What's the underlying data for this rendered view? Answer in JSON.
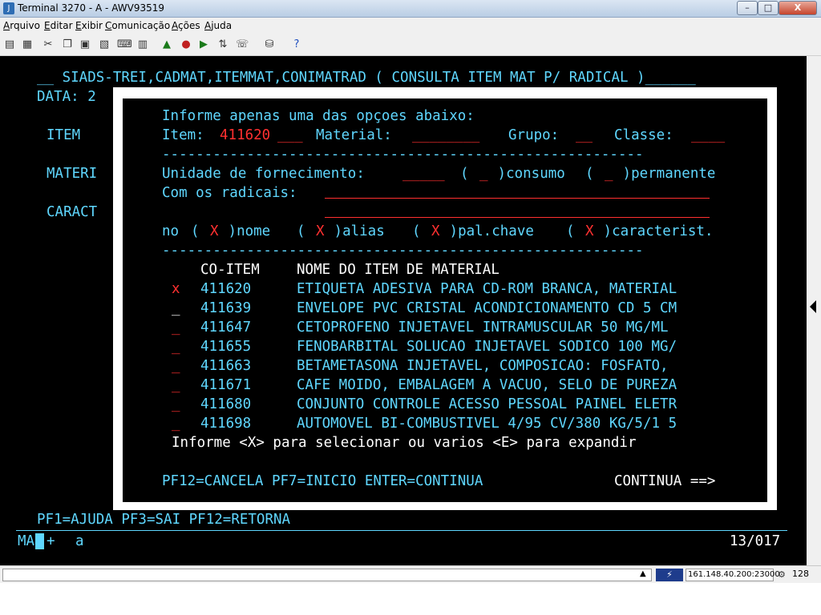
{
  "window": {
    "title": "Terminal 3270 - A - AWV93519",
    "min_label": "–",
    "max_label": "□",
    "close_label": "X"
  },
  "menu": [
    "Arquivo",
    "Editar",
    "Exibir",
    "Comunicação",
    "Ações",
    "Ajuda"
  ],
  "toolbar_icons": [
    "print-icon",
    "print-screen-icon",
    "cut-icon",
    "copy-icon",
    "paste-icon",
    "paste-special-icon",
    "keypad-icon",
    "macro-record-icon",
    "macro-stop-icon",
    "macro-play-icon",
    "file-transfer-icon",
    "chat-icon",
    "disk-icon",
    "help-icon"
  ],
  "terminal": {
    "header": "__ SIADS-TREI,CADMAT,ITEMMAT,CONIMATRAD ( CONSULTA ITEM MAT P/ RADICAL )______",
    "data_label": "DATA: 2",
    "left_labels": [
      "ITEM",
      "MATERI",
      "CARACT"
    ],
    "bottom_pf": "PF1=AJUDA PF3=SAI PF12=RETORNA",
    "oia_left": "MA",
    "oia_plus": "+",
    "oia_a": "a",
    "cursor_pos": "13/017"
  },
  "modal": {
    "instruction": "Informe apenas uma das opçoes abaixo:",
    "item_label": "Item:",
    "item_value": "411620",
    "item_pad": "___",
    "material_label": "Material:",
    "material_value": "________",
    "grupo_label": "Grupo:",
    "grupo_value": "__",
    "classe_label": "Classe:",
    "classe_value": "____",
    "separator": "---------------------------------------------------------",
    "unidade_label": "Unidade de fornecimento:",
    "unidade_value": "_____",
    "consumo_open": "( ",
    "consumo_value": "_",
    "consumo_label": " )consumo",
    "permanente_open": "( ",
    "permanente_value": "_",
    "permanente_label": " )permanente",
    "radicais_label": "Com os radicais:",
    "no_label": "no",
    "opt_open": "( ",
    "opt_mark": "X",
    "opt_nome": " )nome",
    "opt_alias": " )alias",
    "opt_palchave": " )pal.chave",
    "opt_caract": " )caracterist.",
    "col_code": "CO-ITEM",
    "col_name": "NOME DO ITEM DE MATERIAL",
    "rows": [
      {
        "sel": "x",
        "code": "411620",
        "name": "ETIQUETA ADESIVA PARA CD-ROM BRANCA, MATERIAL"
      },
      {
        "sel": "_",
        "code": "411639",
        "name": "ENVELOPE PVC CRISTAL ACONDICIONAMENTO CD 5 CM"
      },
      {
        "sel": "_",
        "code": "411647",
        "name": "CETOPROFENO INJETAVEL INTRAMUSCULAR 50 MG/ML"
      },
      {
        "sel": "_",
        "code": "411655",
        "name": "FENOBARBITAL SOLUCAO INJETAVEL SODICO 100 MG/"
      },
      {
        "sel": "_",
        "code": "411663",
        "name": "BETAMETASONA INJETAVEL, COMPOSICAO: FOSFATO,"
      },
      {
        "sel": "_",
        "code": "411671",
        "name": "CAFE MOIDO, EMBALAGEM A VACUO, SELO DE PUREZA"
      },
      {
        "sel": "_",
        "code": "411680",
        "name": "CONJUNTO CONTROLE ACESSO PESSOAL PAINEL ELETR"
      },
      {
        "sel": "_",
        "code": "411698",
        "name": "AUTOMOVEL BI-COMBUSTIVEL 4/95 CV/380 KG/5/1 5"
      }
    ],
    "hint": "Informe <X> para selecionar ou varios <E> para expandir",
    "pf_keys": "PF12=CANCELA PF7=INICIO ENTER=CONTINUA",
    "continua": "CONTINUA ==>"
  },
  "status": {
    "connection": "161.148.40.200:23000",
    "count": "128"
  }
}
